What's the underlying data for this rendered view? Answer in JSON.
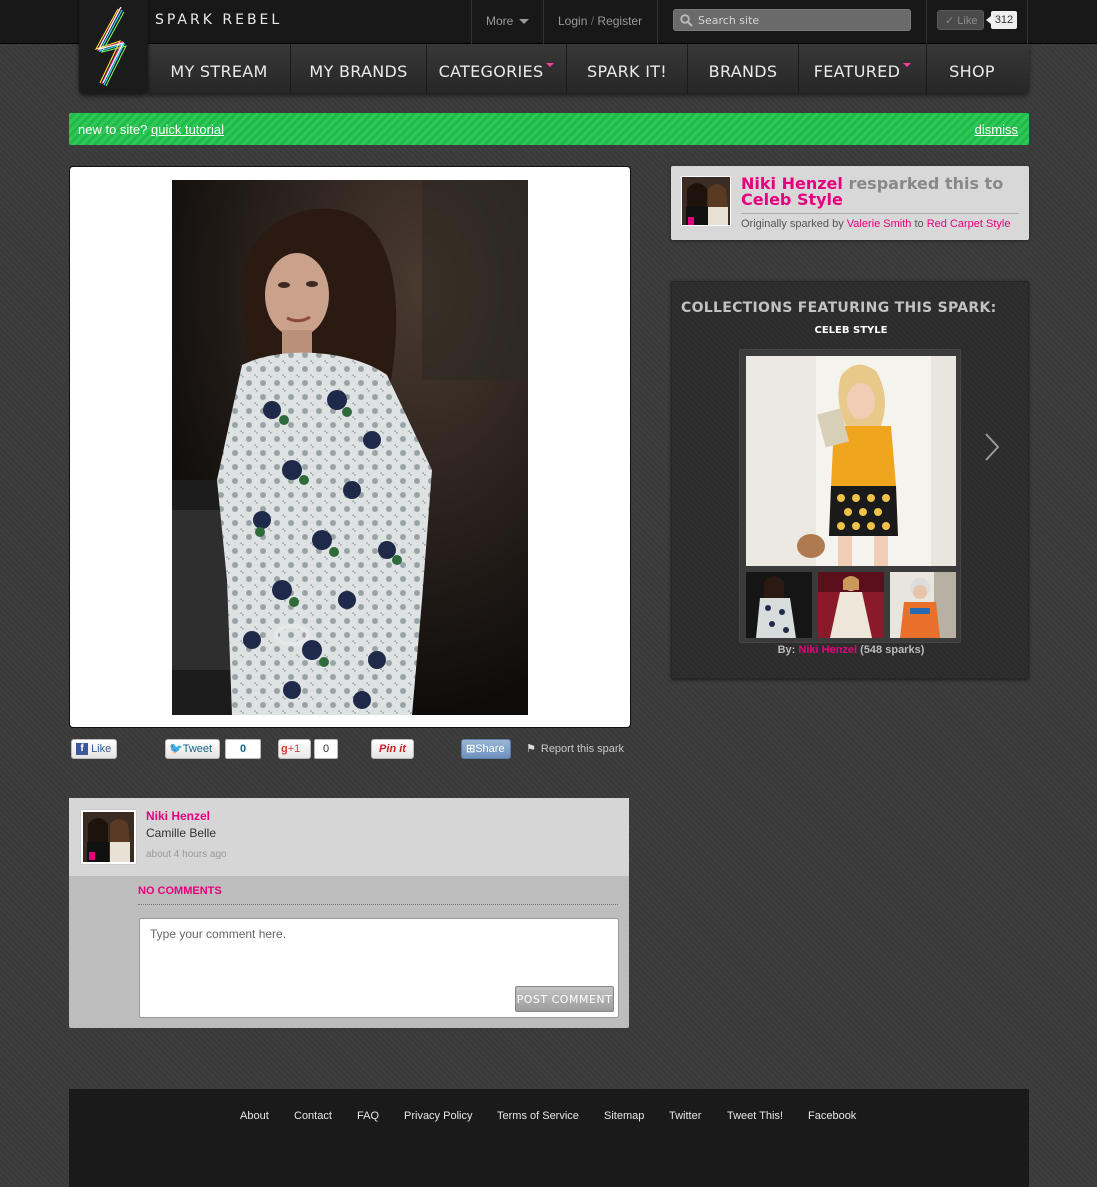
{
  "brand": {
    "name": "SPARK REBEL"
  },
  "topbar": {
    "more_label": "More",
    "login_label": "Login",
    "login_sep": "/",
    "register_label": "Register",
    "search_placeholder": "Search site",
    "fb_like_label": "Like",
    "fb_like_count": "312"
  },
  "nav": {
    "items": [
      {
        "label": "MY STREAM"
      },
      {
        "label": "MY BRANDS"
      },
      {
        "label": "CATEGORIES"
      },
      {
        "label": "SPARK IT!"
      },
      {
        "label": "BRANDS"
      },
      {
        "label": "FEATURED"
      },
      {
        "label": "SHOP"
      }
    ]
  },
  "banner": {
    "prefix": "new to site?",
    "link": "quick tutorial",
    "dismiss": "dismiss"
  },
  "social": {
    "fb_like": "Like",
    "tweet": "Tweet",
    "tweet_count": "0",
    "gplus": "+1",
    "gplus_count": "0",
    "pinit": "Pin it",
    "share": "Share",
    "report": "Report this spark"
  },
  "comment": {
    "user": "Niki Henzel",
    "caption": "Camille Belle",
    "time": "about 4 hours ago",
    "no_comments": "NO COMMENTS",
    "placeholder": "Type your comment here.",
    "post_button": "POST COMMENT"
  },
  "respark": {
    "user": "Niki Henzel",
    "action": "resparked this to",
    "collection": "Celeb Style",
    "orig_prefix": "Originally sparked by",
    "orig_user": "Valerie Smith",
    "orig_to": "to",
    "orig_collection": "Red Carpet Style"
  },
  "collections": {
    "title": "COLLECTIONS FEATURING THIS SPARK:",
    "name": "CELEB STYLE",
    "by_label": "By:",
    "by_user": "Niki Henzel",
    "count": "(548 sparks)"
  },
  "footer": {
    "links": [
      {
        "label": "About"
      },
      {
        "label": "Contact"
      },
      {
        "label": "FAQ"
      },
      {
        "label": "Privacy Policy"
      },
      {
        "label": "Terms of Service"
      },
      {
        "label": "Sitemap"
      },
      {
        "label": "Twitter"
      },
      {
        "label": "Tweet This!"
      },
      {
        "label": "Facebook"
      }
    ]
  },
  "colors": {
    "accent_pink": "#e6007e",
    "banner_green": "#1ec14a",
    "topbar": "#181818"
  }
}
